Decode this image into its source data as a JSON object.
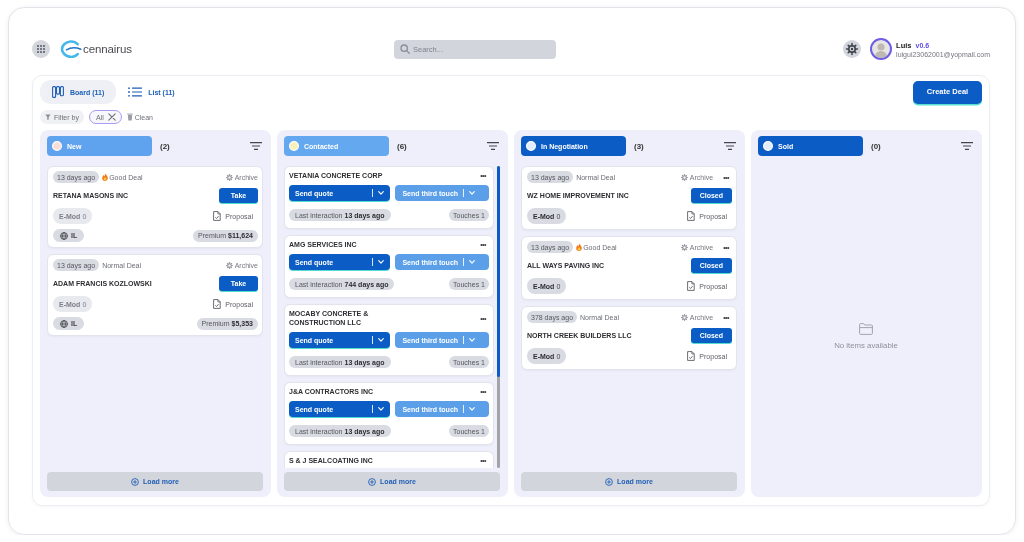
{
  "header": {
    "logo": "cennairus",
    "search": {
      "placeholder": "Search..."
    },
    "user": {
      "name": "Luis",
      "version": "v0.6",
      "email": "luigui23062001@yopmail.com"
    }
  },
  "toolbar": {
    "tabs": [
      {
        "label": "Board (11)",
        "kind": "board",
        "selected": true
      },
      {
        "label": "List (11)",
        "kind": "list",
        "selected": false
      }
    ],
    "create_button": "Create Deal"
  },
  "filters": {
    "label": "Filter by",
    "chips": [
      {
        "label": "All"
      }
    ],
    "clear": "Clean"
  },
  "columns": [
    {
      "title": "New",
      "count": "(2)",
      "color": "#5fa3ee",
      "dot": {
        "color": "#f8ddd8"
      },
      "cards": [
        {
          "kind": "deal",
          "age": "13 days ago",
          "deal_type": "Good Deal",
          "hot": true,
          "archive": "Archive",
          "title": "RETANA MASONS INC",
          "action": "Take",
          "emod": {
            "text": "**E-Mod** 0",
            "disabled": true
          },
          "proposal": "Proposal",
          "location": "IL",
          "premium": "Premium **$11,624**"
        },
        {
          "kind": "deal",
          "age": "13 days ago",
          "deal_type": "Normal Deal",
          "hot": false,
          "archive": "Archive",
          "title": "ADAM FRANCIS KOZLOWSKI",
          "action": "Take",
          "emod": {
            "text": "**E-Mod** 0",
            "disabled": true
          },
          "proposal": "Proposal",
          "location": "IL",
          "premium": "Premium **$5,353**"
        }
      ],
      "load_more": "Load more"
    },
    {
      "title": "Contacted",
      "count": "(6)",
      "color": "#64a8f0",
      "dot": {
        "color": "#fbefb9"
      },
      "cards": [
        {
          "kind": "outreach",
          "title": "VETANIA CONCRETE CORP",
          "menu": "•••",
          "actions": [
            {
              "label": "Send quote",
              "kind": "primary"
            },
            {
              "label": "Send third touch",
              "kind": "secondary"
            }
          ],
          "last_interaction": "Last interaction **13 days ago**",
          "touches": "Touches 1"
        },
        {
          "kind": "outreach",
          "title": "AMG SERVICES INC",
          "menu": "•••",
          "actions": [
            {
              "label": "Send quote",
              "kind": "primary"
            },
            {
              "label": "Send third touch",
              "kind": "secondary"
            }
          ],
          "last_interaction": "Last interaction **744 days ago**",
          "touches": "Touches 1"
        },
        {
          "kind": "outreach",
          "title": "MOCABY CONCRETE & CONSTRUCTION LLC",
          "menu": "•••",
          "actions": [
            {
              "label": "Send quote",
              "kind": "primary"
            },
            {
              "label": "Send third touch",
              "kind": "secondary"
            }
          ],
          "last_interaction": "Last interaction **13 days ago**",
          "touches": "Touches 1"
        },
        {
          "kind": "outreach",
          "title": "J&A CONTRACTORS INC",
          "menu": "•••",
          "actions": [
            {
              "label": "Send quote",
              "kind": "primary"
            },
            {
              "label": "Send third touch",
              "kind": "secondary"
            }
          ],
          "last_interaction": "Last interaction **13 days ago**",
          "touches": "Touches 1"
        },
        {
          "kind": "outreach",
          "title": "S & J SEALCOATING INC",
          "menu": "•••"
        }
      ],
      "load_more": "Load more"
    },
    {
      "title": "In Negotiation",
      "count": "(3)",
      "color": "#0b5cc4",
      "dot": {
        "color": "#e4edfb"
      },
      "cards": [
        {
          "kind": "deal",
          "age": "13 days ago",
          "deal_type": "Normal Deal",
          "hot": false,
          "archive": "Archive",
          "menu": "•••",
          "title": "WZ HOME IMPROVEMENT INC",
          "action": "Closed",
          "emod": {
            "text": "**E-Mod** 0",
            "disabled": false
          },
          "proposal": "Proposal"
        },
        {
          "kind": "deal",
          "age": "13 days ago",
          "deal_type": "Good Deal",
          "hot": true,
          "archive": "Archive",
          "menu": "•••",
          "title": "ALL WAYS PAVING INC",
          "action": "Closed",
          "emod": {
            "text": "**E-Mod** 0",
            "disabled": false
          },
          "proposal": "Proposal"
        },
        {
          "kind": "deal",
          "age": "378 days ago",
          "deal_type": "Normal Deal",
          "hot": false,
          "archive": "Archive",
          "menu": "•••",
          "title": "NORTH CREEK BUILDERS LLC",
          "action": "Closed",
          "emod": {
            "text": "**E-Mod** 0",
            "disabled": false
          },
          "proposal": "Proposal"
        }
      ],
      "load_more": "Load more"
    },
    {
      "title": "Sold",
      "count": "(0)",
      "color": "#0b5cc4",
      "dot": {
        "color": "#e4edfb"
      },
      "empty": "No items available"
    }
  ]
}
